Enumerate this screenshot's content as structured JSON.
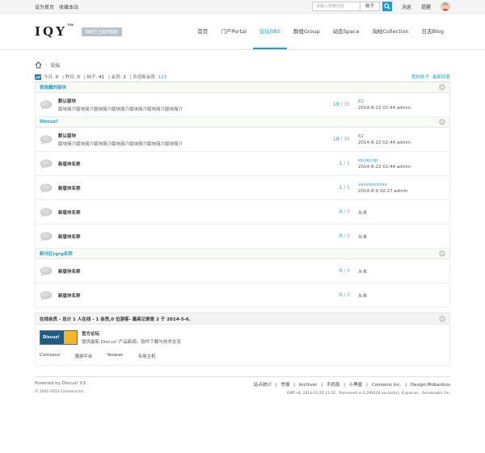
{
  "topbar": {
    "left_links": [
      "设为首页",
      "收藏本站"
    ],
    "search_placeholder": "请输入搜索内容",
    "search_scope": "帖子",
    "right_links": [
      "消息",
      "提醒"
    ]
  },
  "header": {
    "logo_text": "IQY",
    "logo_tm": "TM",
    "logo_badge": "模板巴士提供模板",
    "nav": [
      {
        "label": "首页",
        "active": false
      },
      {
        "label": "门户Portal",
        "active": false
      },
      {
        "label": "论坛BBS",
        "active": true
      },
      {
        "label": "群组Group",
        "active": false
      },
      {
        "label": "动态Space",
        "active": false
      },
      {
        "label": "淘帖Collection",
        "active": false
      },
      {
        "label": "日志Blog",
        "active": false
      }
    ]
  },
  "breadcrumb": {
    "sep": "›",
    "current": "论坛"
  },
  "stats": {
    "today_label": "今日:",
    "today": "0",
    "yesterday_label": "昨日:",
    "yesterday": "0",
    "posts_label": "帖子:",
    "posts": "41",
    "members_label": "会员:",
    "members": "2",
    "newest_label": "欢迎新会员:",
    "newest": "123",
    "right_links": [
      "我的帖子",
      "最新回复"
    ]
  },
  "groups": [
    {
      "title": "我收藏的版块",
      "forums": [
        {
          "name": "默认版块",
          "desc": "版块简介版块简介版块简介版块简介版块简介版块简介版块简介",
          "threads": "19",
          "posts": "35",
          "last_title": "62",
          "last_meta": "2014-8-22 02:44 admin",
          "never": ""
        }
      ]
    },
    {
      "title": "Discuz!",
      "forums": [
        {
          "name": "默认版块",
          "desc": "版块简介版块简介版块简介版块简介版块简介版块简介版块简介",
          "threads": "19",
          "posts": "35",
          "last_title": "62",
          "last_meta": "2014-8-22 02:44 admin",
          "never": ""
        },
        {
          "name": "新版块名称",
          "desc": "",
          "threads": "1",
          "posts": "1",
          "last_title": "op;op;op",
          "last_meta": "2014-8-22 02:44 admin",
          "never": ""
        },
        {
          "name": "新版块名称",
          "desc": "",
          "threads": "1",
          "posts": "5",
          "last_title": "vvvvvvvvvvv",
          "last_meta": "2014-8-9 02:27 admin",
          "never": ""
        },
        {
          "name": "新版块名称",
          "desc": "",
          "threads": "0",
          "posts": "0",
          "last_title": "",
          "last_meta": "",
          "never": "从未"
        },
        {
          "name": "新版块名称",
          "desc": "",
          "threads": "0",
          "posts": "0",
          "last_title": "",
          "last_meta": "",
          "never": "从未"
        }
      ]
    },
    {
      "title": "新分区rgrg名称",
      "forums": [
        {
          "name": "新版块名称",
          "desc": "",
          "threads": "0",
          "posts": "0",
          "last_title": "",
          "last_meta": "",
          "never": "从未"
        },
        {
          "name": "新版块名称",
          "desc": "",
          "threads": "0",
          "posts": "0",
          "last_title": "",
          "last_meta": "",
          "never": "从未"
        }
      ]
    }
  ],
  "online": {
    "text": "在线会员 - 总计 1 人在线 - 1 会员,0 位游客- 最高记录是 2 于 2014-5-6."
  },
  "links": {
    "logo_text": "Discuz!",
    "title": "官方论坛",
    "desc": "提供最新 Discuz! 产品新闻、软件下载与技术交流",
    "items": [
      "Comsenz",
      "漫游平台",
      "Yeswan",
      "专用主机"
    ]
  },
  "footer": {
    "powered": "Powered by Discuz! X3",
    "copyright": "© 2001-2013 Comsenz Inc.",
    "links": [
      "站点统计",
      "|",
      "举报",
      "|",
      "Archiver",
      "|",
      "手机版",
      "|",
      "小黑屋",
      "|",
      "Comsenz Inc.",
      "|",
      "Design:Mobanbus"
    ],
    "info": "GMT+8, 2014-12-20 13:32 , Processed in 0.299124 second(s), 6 queries , Accelerator On."
  },
  "colors": {
    "accent": "#1e9ecf",
    "group_bg": "#f7fbf4"
  }
}
